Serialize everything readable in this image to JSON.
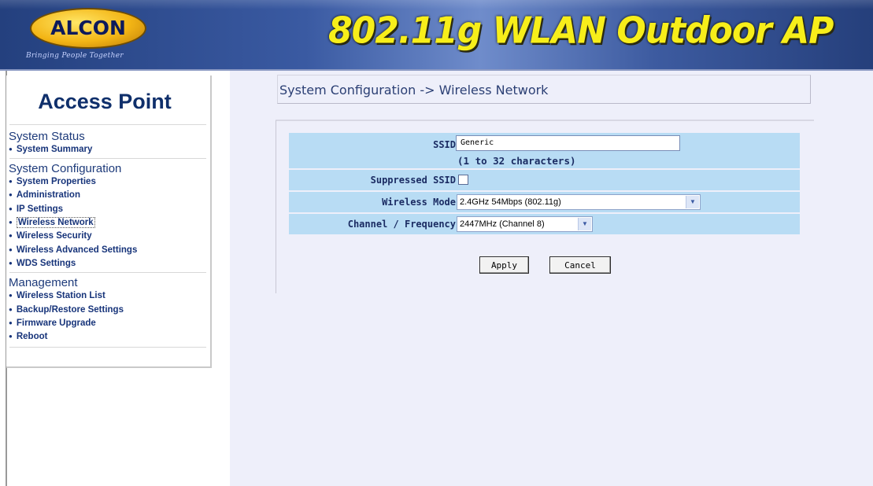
{
  "header": {
    "logo_text": "ALCON",
    "logo_tagline": "Bringing People Together",
    "product_title": "802.11g WLAN Outdoor AP"
  },
  "sidebar": {
    "title": "Access Point",
    "sections": [
      {
        "heading": "System Status",
        "items": [
          "System Summary"
        ]
      },
      {
        "heading": "System Configuration",
        "items": [
          "System Properties",
          "Administration",
          "IP Settings",
          "Wireless Network",
          "Wireless Security",
          "Wireless Advanced Settings",
          "WDS Settings"
        ]
      },
      {
        "heading": "Management",
        "items": [
          "Wireless Station List",
          "Backup/Restore Settings",
          "Firmware Upgrade",
          "Reboot"
        ]
      }
    ],
    "active_item": "Wireless Network"
  },
  "main": {
    "breadcrumb": "System Configuration -> Wireless Network",
    "form": {
      "ssid_label": "SSID",
      "ssid_value": "Generic",
      "ssid_hint": "(1 to 32 characters)",
      "suppressed_label": "Suppressed SSID",
      "suppressed_checked": false,
      "mode_label": "Wireless Mode",
      "mode_value": "2.4GHz 54Mbps (802.11g)",
      "channel_label": "Channel / Frequency",
      "channel_value": "2447MHz (Channel 8)"
    },
    "buttons": {
      "apply": "Apply",
      "cancel": "Cancel"
    }
  },
  "colors": {
    "header_blue": "#3a5aa2",
    "title_yellow": "#f7ee1a",
    "content_bg": "#eeeffa",
    "row_bg": "#b8dcf4",
    "nav_text": "#17347a"
  }
}
